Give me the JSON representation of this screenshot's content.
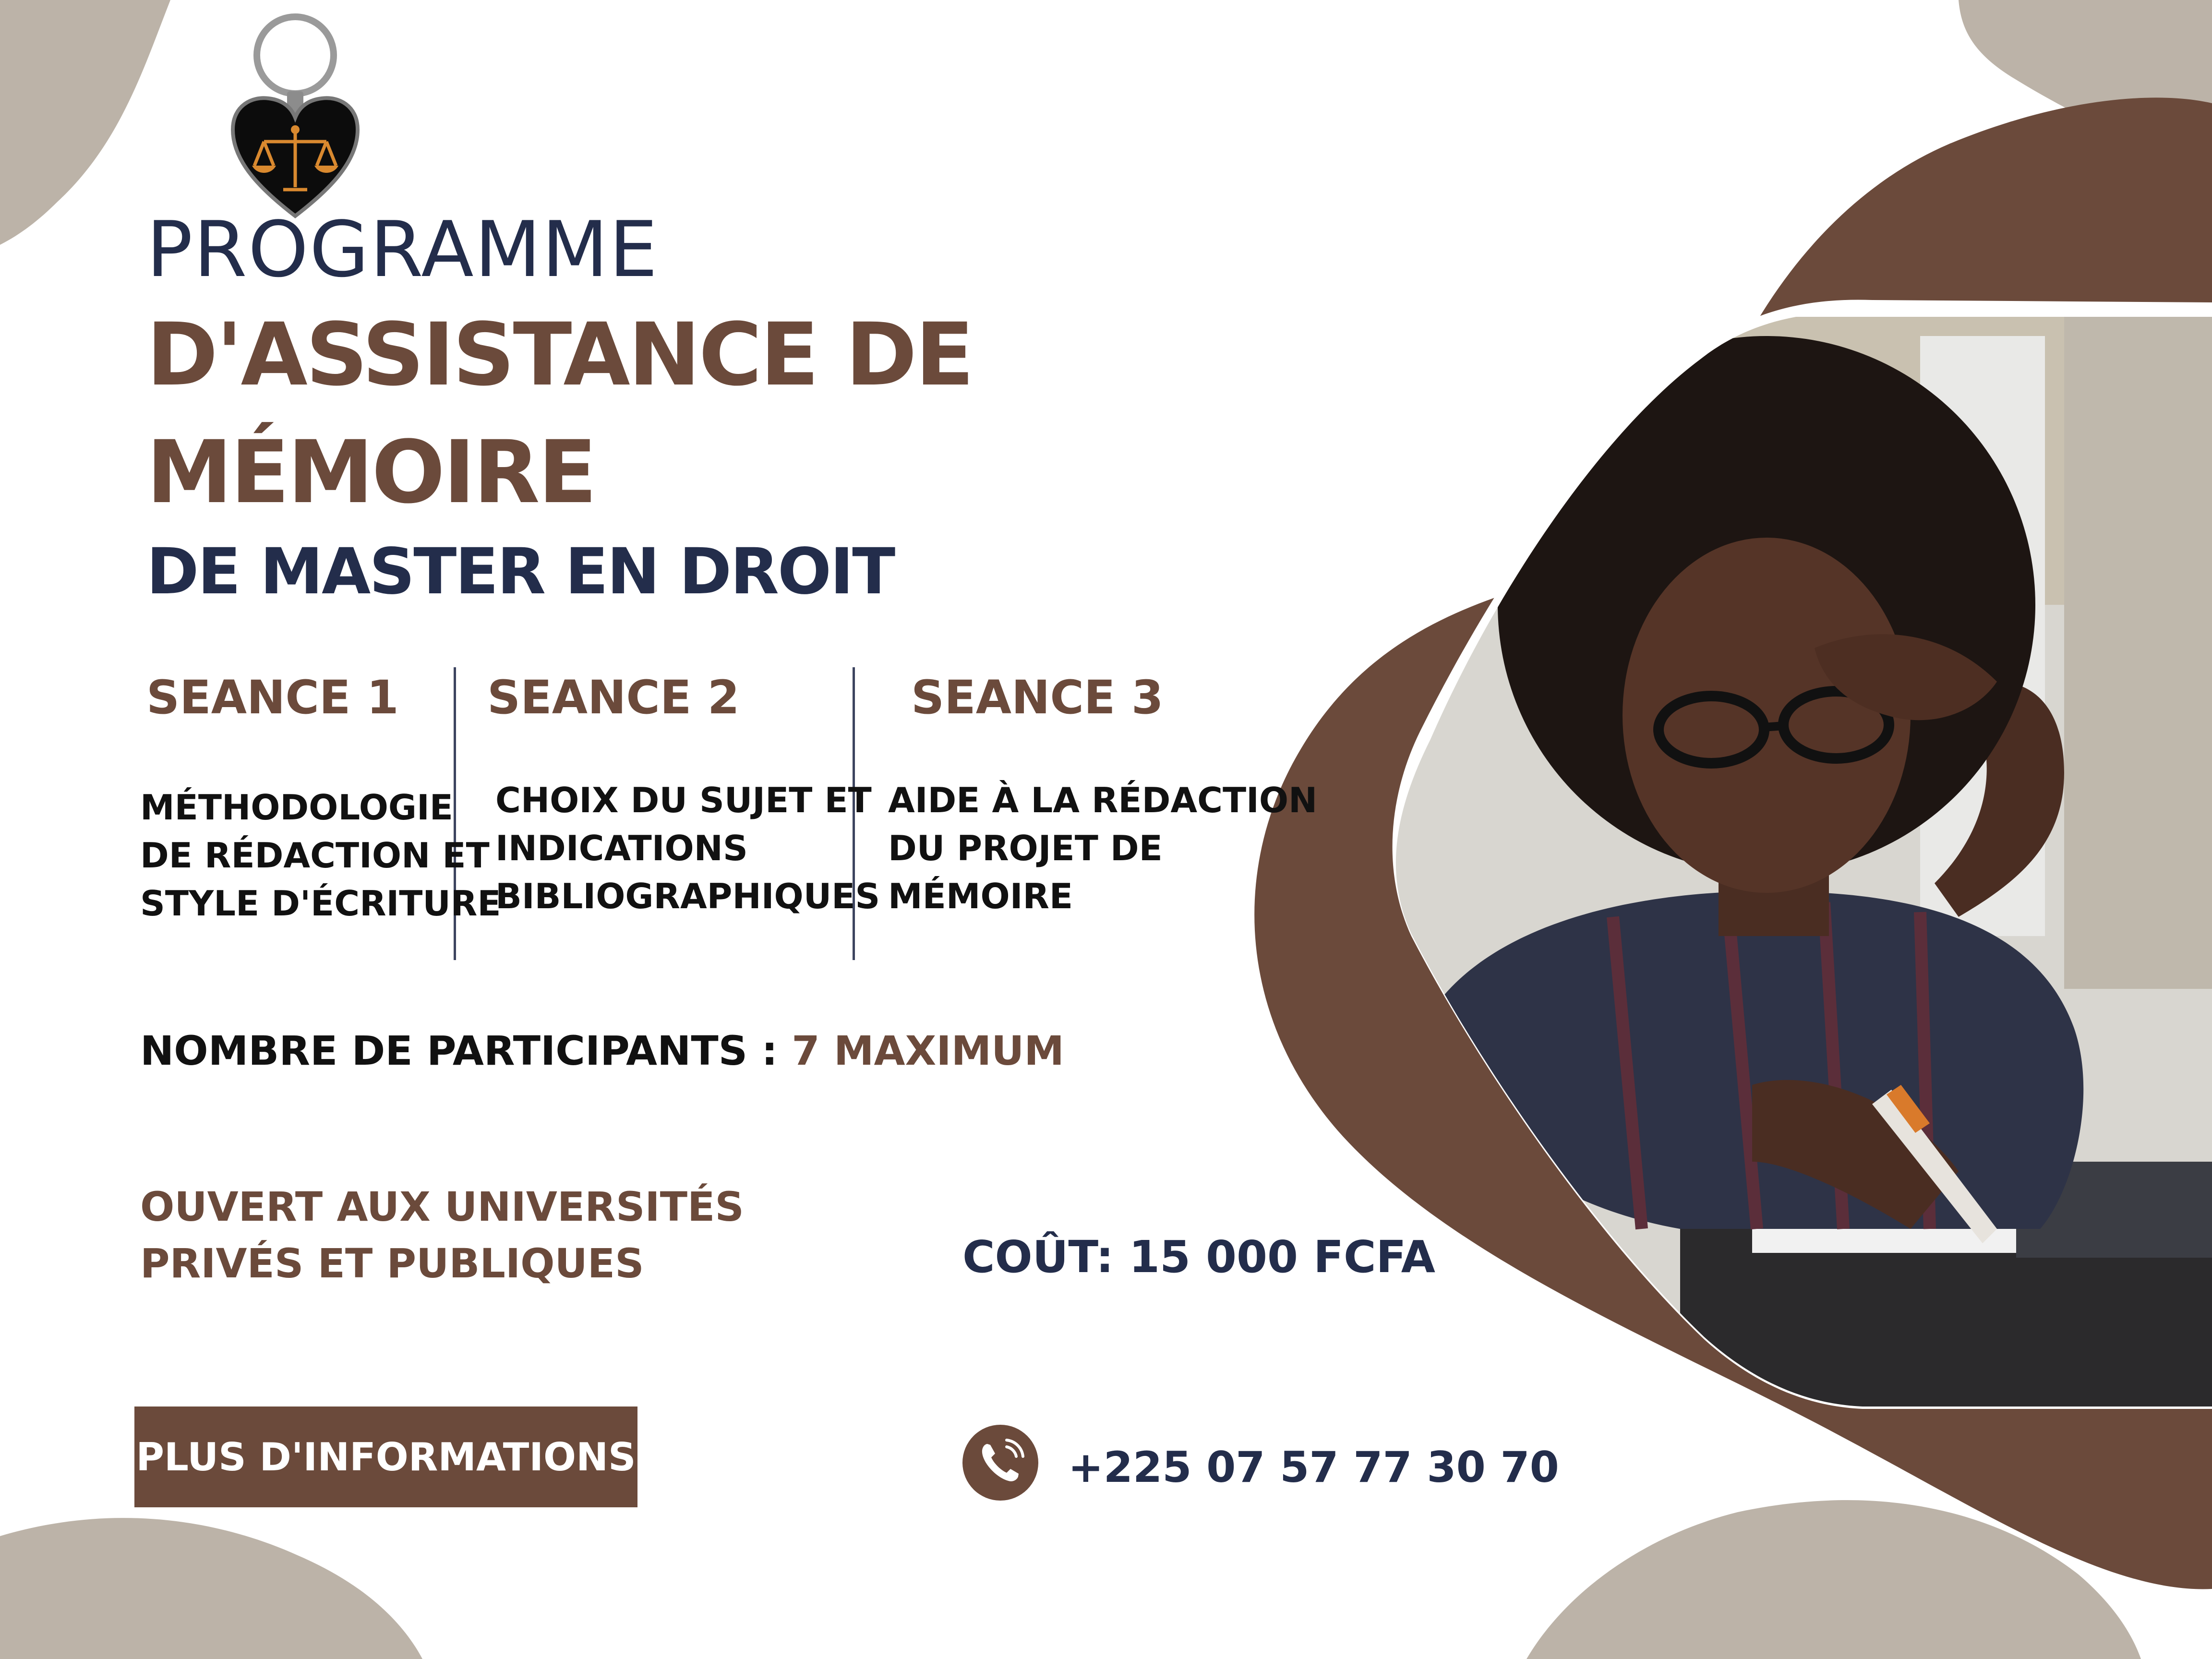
{
  "colors": {
    "brown": "#6b4a3b",
    "navy": "#232d4b",
    "beige": "#bcb3a8",
    "white": "#ffffff"
  },
  "logo": {
    "icon": "scales-of-justice-keychain"
  },
  "title": {
    "line_programme": "PROGRAMME",
    "line_assistance": "D'ASSISTANCE DE",
    "line_memoire": "MÉMOIRE",
    "line_master": "DE MASTER EN DROIT"
  },
  "seances": [
    {
      "head": "SEANCE 1",
      "lines": [
        "MÉTHODOLOGIE",
        "DE RÉDACTION ET",
        "STYLE D'ÉCRITURE"
      ]
    },
    {
      "head": "SEANCE 2",
      "lines": [
        "CHOIX DU SUJET ET",
        "INDICATIONS",
        "BIBLIOGRAPHIQUES"
      ]
    },
    {
      "head": "SEANCE 3",
      "lines": [
        "AIDE À LA RÉDACTION",
        "DU PROJET DE",
        "MÉMOIRE"
      ]
    }
  ],
  "participants": {
    "label": "NOMBRE DE PARTICIPANTS :",
    "value": "7  MAXIMUM"
  },
  "ouvert": {
    "line1": "OUVERT AUX UNIVERSITÉS",
    "line2": "PRIVÉS ET PUBLIQUES"
  },
  "cout": "COÛT: 15 000 FCFA",
  "cta": {
    "label": "PLUS D'INFORMATIONS"
  },
  "contact": {
    "icon": "phone-icon",
    "number": "+225 07 57 77 30 70"
  },
  "photo": {
    "subject": "student-writing-photo"
  }
}
